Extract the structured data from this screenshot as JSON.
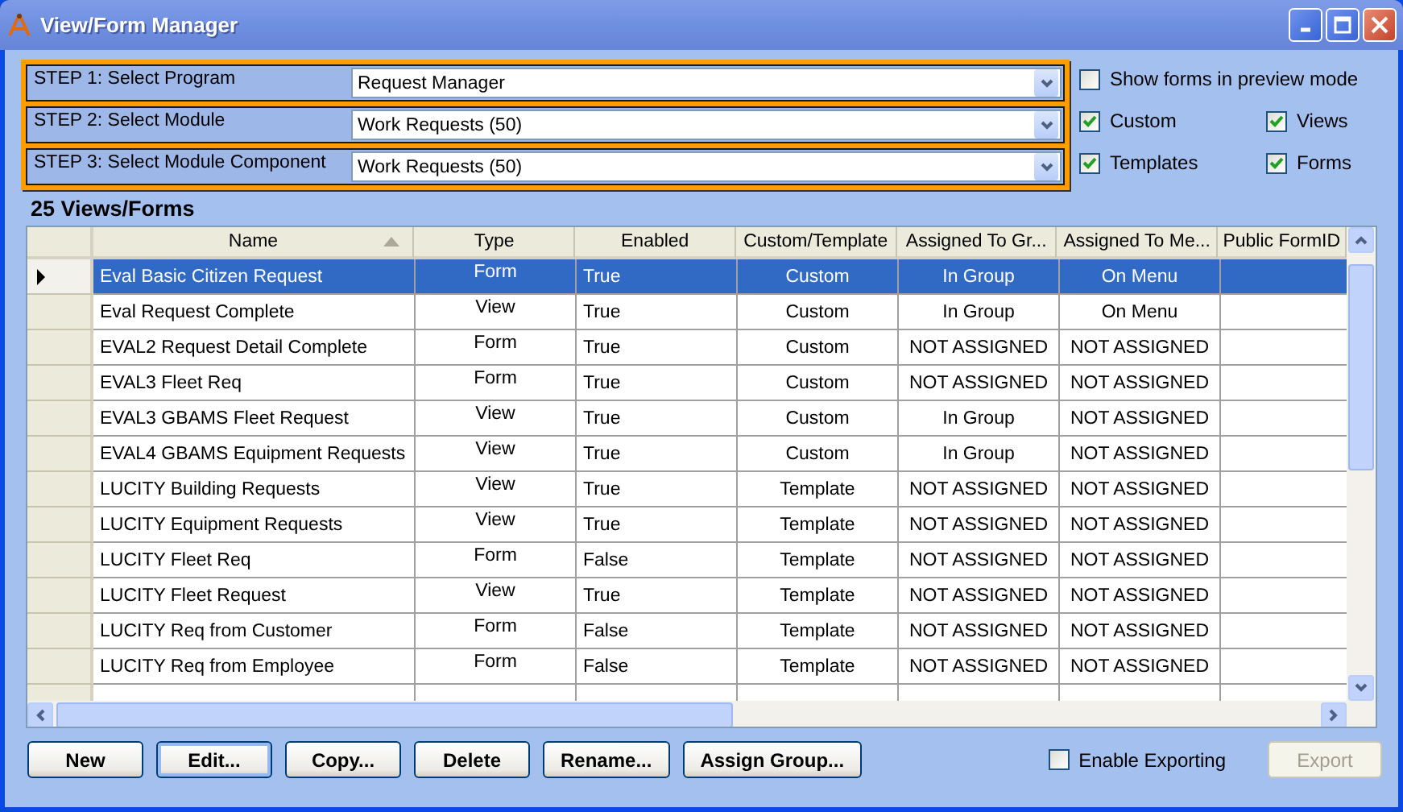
{
  "window": {
    "title": "View/Form Manager"
  },
  "steps": [
    {
      "label": "STEP 1: Select Program",
      "value": "Request Manager"
    },
    {
      "label": "STEP 2: Select Module",
      "value": "Work Requests (50)"
    },
    {
      "label": "STEP 3: Select Module Component",
      "value": "Work Requests (50)"
    }
  ],
  "options": [
    {
      "label": "Show forms in preview mode",
      "checked": false
    },
    {
      "label": "Custom",
      "checked": true
    },
    {
      "label": "Views",
      "checked": true
    },
    {
      "label": "Templates",
      "checked": true
    },
    {
      "label": "Forms",
      "checked": true
    }
  ],
  "list_title": "25 Views/Forms",
  "table": {
    "columns": [
      {
        "label": "Name",
        "sorted": true
      },
      {
        "label": "Type",
        "sorted": false
      },
      {
        "label": "Enabled",
        "sorted": false
      },
      {
        "label": "Custom/Template",
        "sorted": false
      },
      {
        "label": "Assigned To Gr...",
        "sorted": false
      },
      {
        "label": "Assigned To Me...",
        "sorted": false
      },
      {
        "label": "Public FormID",
        "sorted": false
      }
    ],
    "rows": [
      {
        "selected": true,
        "cells": [
          "Eval Basic Citizen Request",
          "Form",
          "True",
          "Custom",
          "In Group",
          "On Menu"
        ]
      },
      {
        "selected": false,
        "cells": [
          "Eval Request Complete",
          "View",
          "True",
          "Custom",
          "In Group",
          "On Menu"
        ]
      },
      {
        "selected": false,
        "cells": [
          "EVAL2 Request Detail Complete",
          "Form",
          "True",
          "Custom",
          "NOT ASSIGNED",
          "NOT ASSIGNED"
        ]
      },
      {
        "selected": false,
        "cells": [
          "EVAL3 Fleet Req",
          "Form",
          "True",
          "Custom",
          "NOT ASSIGNED",
          "NOT ASSIGNED"
        ]
      },
      {
        "selected": false,
        "cells": [
          "EVAL3 GBAMS Fleet Request",
          "View",
          "True",
          "Custom",
          "In Group",
          "NOT ASSIGNED"
        ]
      },
      {
        "selected": false,
        "cells": [
          "EVAL4 GBAMS Equipment Requests",
          "View",
          "True",
          "Custom",
          "In Group",
          "NOT ASSIGNED"
        ]
      },
      {
        "selected": false,
        "cells": [
          "LUCITY Building Requests",
          "View",
          "True",
          "Template",
          "NOT ASSIGNED",
          "NOT ASSIGNED"
        ]
      },
      {
        "selected": false,
        "cells": [
          "LUCITY Equipment Requests",
          "View",
          "True",
          "Template",
          "NOT ASSIGNED",
          "NOT ASSIGNED"
        ]
      },
      {
        "selected": false,
        "cells": [
          "LUCITY Fleet Req",
          "Form",
          "False",
          "Template",
          "NOT ASSIGNED",
          "NOT ASSIGNED"
        ]
      },
      {
        "selected": false,
        "cells": [
          "LUCITY Fleet Request",
          "View",
          "True",
          "Template",
          "NOT ASSIGNED",
          "NOT ASSIGNED"
        ]
      },
      {
        "selected": false,
        "cells": [
          "LUCITY Req from Customer",
          "Form",
          "False",
          "Template",
          "NOT ASSIGNED",
          "NOT ASSIGNED"
        ]
      },
      {
        "selected": false,
        "cells": [
          "LUCITY Req from Employee",
          "Form",
          "False",
          "Template",
          "NOT ASSIGNED",
          "NOT ASSIGNED"
        ]
      }
    ]
  },
  "buttons": [
    {
      "label": "New",
      "focused": false
    },
    {
      "label": "Edit...",
      "focused": true
    },
    {
      "label": "Copy...",
      "focused": false
    },
    {
      "label": "Delete",
      "focused": false
    },
    {
      "label": "Rename...",
      "focused": false
    },
    {
      "label": "Assign Group...",
      "focused": false
    }
  ],
  "exporting": {
    "label": "Enable Exporting",
    "checked": false
  },
  "export_button": {
    "label": "Export",
    "disabled": true
  }
}
